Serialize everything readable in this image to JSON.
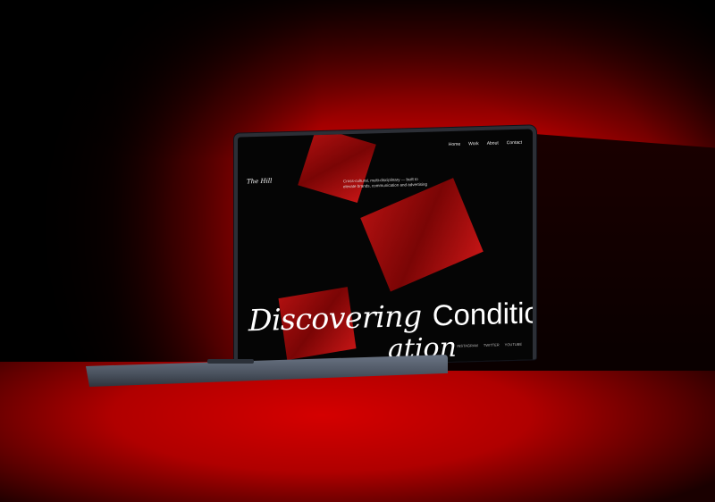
{
  "site": {
    "logo": "The Hill",
    "nav": [
      "Home",
      "Work",
      "About",
      "Contact"
    ],
    "tagline": "Cross-cultural, multi-disciplinary — built to elevate brands, communication and advertising",
    "headline_serif": "Discovering",
    "headline_sans": "Conditions",
    "headline_line2": "ation",
    "social": [
      "INSTAGRAM",
      "TWITTER",
      "YOUTUBE"
    ]
  },
  "colors": {
    "background": "#cc0000",
    "screen": "#050505",
    "laptop": "#4d5562",
    "accent": "#b01010"
  }
}
